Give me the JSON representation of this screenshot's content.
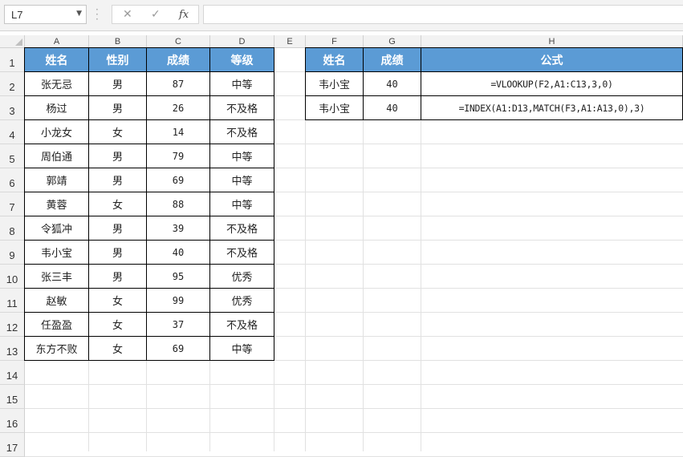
{
  "formula_bar": {
    "name_box": "L7",
    "name_box_icon": "chevron-down-icon",
    "cancel_icon": "close-icon",
    "enter_icon": "check-icon",
    "fx_label": "fx",
    "formula": ""
  },
  "columns": [
    "A",
    "B",
    "C",
    "D",
    "E",
    "F",
    "G",
    "H"
  ],
  "rows": [
    "1",
    "2",
    "3",
    "4",
    "5",
    "6",
    "7",
    "8",
    "9",
    "10",
    "11",
    "12",
    "13",
    "14",
    "15",
    "16",
    "17"
  ],
  "table1": {
    "headers": [
      "姓名",
      "性别",
      "成绩",
      "等级"
    ],
    "rows": [
      [
        "张无忌",
        "男",
        "87",
        "中等"
      ],
      [
        "杨过",
        "男",
        "26",
        "不及格"
      ],
      [
        "小龙女",
        "女",
        "14",
        "不及格"
      ],
      [
        "周伯通",
        "男",
        "79",
        "中等"
      ],
      [
        "郭靖",
        "男",
        "69",
        "中等"
      ],
      [
        "黄蓉",
        "女",
        "88",
        "中等"
      ],
      [
        "令狐冲",
        "男",
        "39",
        "不及格"
      ],
      [
        "韦小宝",
        "男",
        "40",
        "不及格"
      ],
      [
        "张三丰",
        "男",
        "95",
        "优秀"
      ],
      [
        "赵敏",
        "女",
        "99",
        "优秀"
      ],
      [
        "任盈盈",
        "女",
        "37",
        "不及格"
      ],
      [
        "东方不败",
        "女",
        "69",
        "中等"
      ]
    ]
  },
  "table2": {
    "headers": [
      "姓名",
      "成绩",
      "公式"
    ],
    "rows": [
      [
        "韦小宝",
        "40",
        "=VLOOKUP(F2,A1:C13,3,0)"
      ],
      [
        "韦小宝",
        "40",
        "=INDEX(A1:D13,MATCH(F3,A1:A13,0),3)"
      ]
    ]
  },
  "colors": {
    "header_fill": "#5b9bd5",
    "header_text": "#ffffff",
    "border": "#000000"
  }
}
